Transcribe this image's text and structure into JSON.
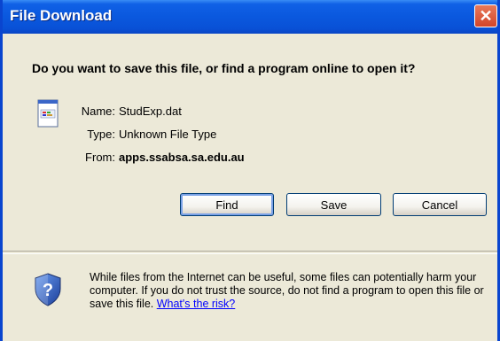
{
  "window": {
    "title": "File Download",
    "close_icon": "close-icon"
  },
  "dialog": {
    "question": "Do you want to save this file, or find a program online to open it?",
    "file_icon": "data-file-icon",
    "name_label": "Name:",
    "name_value": "StudExp.dat",
    "type_label": "Type:",
    "type_value": "Unknown File Type",
    "from_label": "From:",
    "from_value": "apps.ssabsa.sa.edu.au"
  },
  "buttons": {
    "find": "Find",
    "save": "Save",
    "cancel": "Cancel"
  },
  "warning": {
    "icon": "security-shield-icon",
    "text": "While files from the Internet can be useful, some files can potentially harm your computer. If you do not trust the source, do not find a program to open this file or save this file. ",
    "link": "What's the risk?"
  },
  "colors": {
    "titlebar": "#0a58de",
    "dialog_bg": "#ece9d8",
    "close_button": "#d2452a",
    "link": "#0000ff"
  }
}
